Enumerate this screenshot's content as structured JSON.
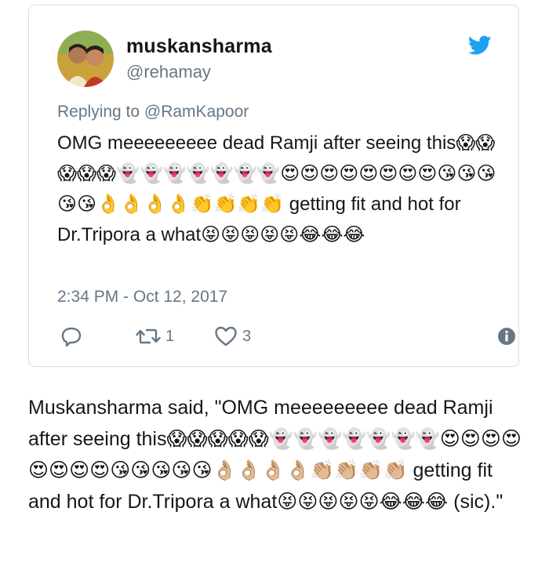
{
  "tweet": {
    "display_name": "muskansharma",
    "handle": "@rehamay",
    "replying_to": "Replying to @RamKapoor",
    "text": "OMG meeeeeeeee dead Ramji after seeing this😱😱😱😱😱👻👻👻👻👻👻👻😍😍😍😍😍😍😍😍😘😘😘😘😘👌👌👌👌👏👏👏👏 getting fit and hot for Dr.Tripora a what😝😝😝😝😝😂😂😂",
    "timestamp": "2:34 PM - Oct 12, 2017",
    "retweet_count": "1",
    "like_count": "3",
    "accent_color": "#1da1f2"
  },
  "caption": {
    "text": "Muskansharma said, \"OMG meeeeeeeee dead Ramji after seeing this😱😱😱😱😱👻👻👻👻👻👻👻😍😍😍😍😍😍😍😍😘😘😘😘😘👌🏼👌🏼👌🏼👌🏼👏🏼👏🏼👏🏼👏🏼 getting fit and hot for Dr.Tripora a what😝😝😝😝😝😂😂😂 (sic).\""
  },
  "icons": {
    "bird": "twitter-bird-icon",
    "reply": "reply-icon",
    "retweet": "retweet-icon",
    "like": "heart-icon",
    "info": "info-icon"
  }
}
